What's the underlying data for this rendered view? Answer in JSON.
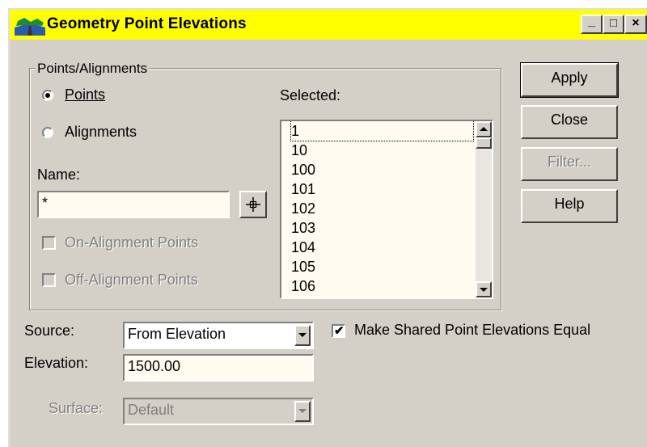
{
  "window": {
    "title": "Geometry Point Elevations",
    "minimize_glyph": "_",
    "maximize_glyph": "□",
    "close_glyph": "×"
  },
  "points_alignments": {
    "group_label": "Points/Alignments",
    "points_radio_label": "Points",
    "alignments_radio_label": "Alignments",
    "selected_option": "Points",
    "name_label": "Name:",
    "name_value": "*",
    "pick_icon": "crosshair-icon",
    "on_alignment_label": "On-Alignment Points",
    "on_alignment_checked": false,
    "off_alignment_label": "Off-Alignment Points",
    "off_alignment_checked": false,
    "selected_label": "Selected:",
    "selected_items": [
      "1",
      "10",
      "100",
      "101",
      "102",
      "103",
      "104",
      "105",
      "106"
    ]
  },
  "buttons": {
    "apply": "Apply",
    "close": "Close",
    "filter": "Filter...",
    "help": "Help"
  },
  "bottom": {
    "source_label": "Source:",
    "source_value": "From Elevation",
    "elevation_label": "Elevation:",
    "elevation_value": "1500.00",
    "surface_label": "Surface:",
    "surface_value": "Default",
    "make_equal_label": "Make Shared Point Elevations Equal",
    "make_equal_checked": true
  },
  "colors": {
    "titlebar": "#ffff00",
    "dialog_bg": "#d4d0c8",
    "field_bg": "#fffbf0"
  }
}
